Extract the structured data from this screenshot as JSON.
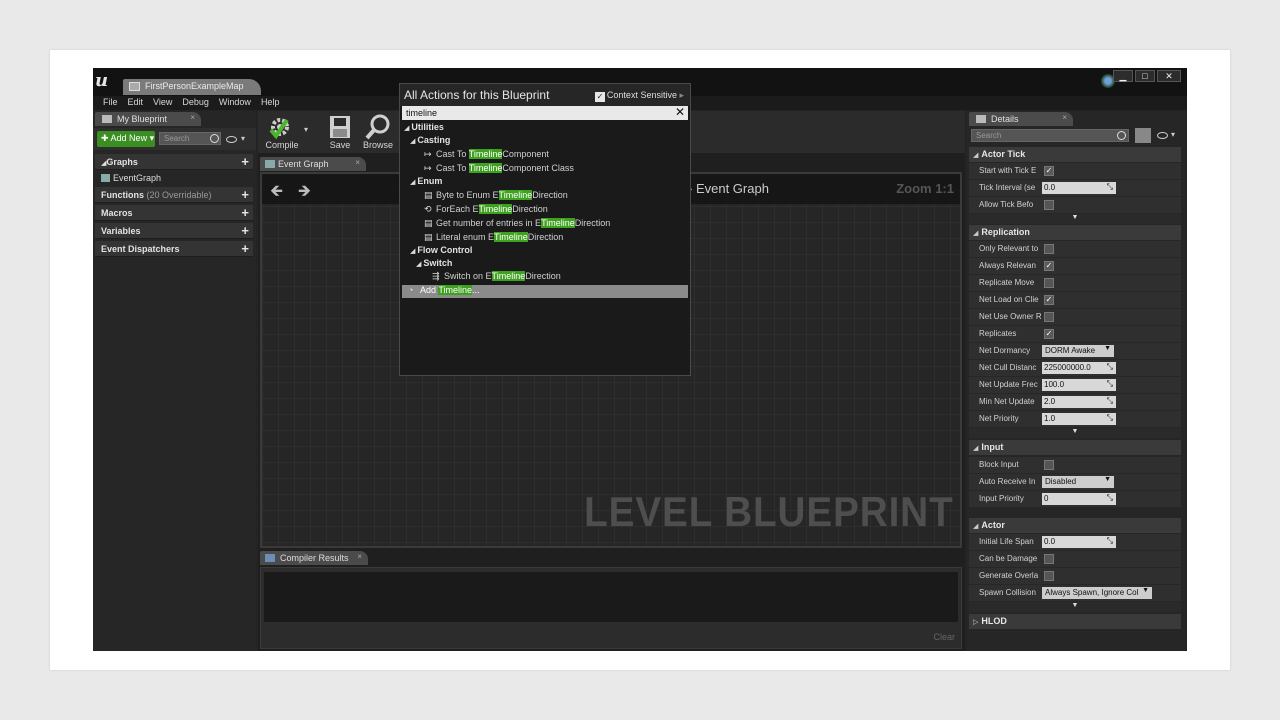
{
  "window": {
    "tab_title": "FirstPersonExampleMap",
    "logo_text": "u",
    "minimize": "▁",
    "maximize": "□",
    "close": "✕"
  },
  "menu": [
    "File",
    "Edit",
    "View",
    "Debug",
    "Window",
    "Help"
  ],
  "my_blueprint": {
    "tab_label": "My Blueprint",
    "add_new_label": "Add New",
    "search_placeholder": "Search",
    "sections": {
      "graphs": "Graphs",
      "graph_item": "EventGraph",
      "functions": "Functions",
      "functions_sub": "(20 Overridable)",
      "macros": "Macros",
      "variables": "Variables",
      "event_dispatchers": "Event Dispatchers"
    }
  },
  "toolbar": {
    "compile": "Compile",
    "save": "Save",
    "browse": "Browse"
  },
  "graph": {
    "tab_label": "Event Graph",
    "breadcrumb": "Event Graph",
    "zoom": "Zoom 1:1",
    "watermark": "LEVEL BLUEPRINT"
  },
  "compiler": {
    "tab_label": "Compiler Results",
    "clear_label": "Clear"
  },
  "actions_popup": {
    "title": "All Actions for this Blueprint",
    "context_label": "Context Sensitive",
    "search_value": "timeline",
    "utilities": "Utilities",
    "casting": "Casting",
    "cast1_pre": "Cast To ",
    "cast_hl": "Timeline",
    "cast1_post": "Component",
    "cast2_post": "Component Class",
    "enum": "Enum",
    "byte_pre": "Byte to Enum E",
    "hl": "Timeline",
    "direction": "Direction",
    "foreach_pre": "ForEach E",
    "getnum_pre": "Get number of entries in E",
    "literal_pre": "Literal enum E",
    "flow_control": "Flow Control",
    "switch": "Switch",
    "switch_pre": "Switch on E",
    "add_pre": "Add ",
    "add_post": "..."
  },
  "details": {
    "tab_label": "Details",
    "search_placeholder": "Search",
    "actor_tick": {
      "title": "Actor Tick",
      "start_with_tick": "Start with Tick E",
      "tick_interval": "Tick Interval (se",
      "tick_interval_value": "0.0",
      "allow_tick_before": "Allow Tick Befo"
    },
    "replication": {
      "title": "Replication",
      "only_relevant": "Only Relevant to",
      "always_relevant": "Always Relevan",
      "replicate_movement": "Replicate Move",
      "net_load_on_client": "Net Load on Clie",
      "net_use_owner": "Net Use Owner R",
      "replicates": "Replicates",
      "net_dormancy": "Net Dormancy",
      "net_dormancy_value": "DORM Awake",
      "net_cull_distance": "Net Cull Distanc",
      "net_cull_distance_value": "225000000.0",
      "net_update_freq": "Net Update Frec",
      "net_update_freq_value": "100.0",
      "min_net_update": "Min Net Update",
      "min_net_update_value": "2.0",
      "net_priority": "Net Priority",
      "net_priority_value": "1.0"
    },
    "input": {
      "title": "Input",
      "block_input": "Block Input",
      "auto_receive": "Auto Receive In",
      "auto_receive_value": "Disabled",
      "input_priority": "Input Priority",
      "input_priority_value": "0"
    },
    "actor": {
      "title": "Actor",
      "initial_life_span": "Initial Life Span",
      "initial_life_span_value": "0.0",
      "can_be_damaged": "Can be Damage",
      "generate_overlap": "Generate Overla",
      "spawn_collision": "Spawn Collision",
      "spawn_collision_value": "Always Spawn, Ignore Col"
    },
    "hlod": {
      "title": "HLOD"
    }
  },
  "colors": {
    "highlight": "#3ea120",
    "add_new": "#3b8f22",
    "background": "#242424"
  }
}
